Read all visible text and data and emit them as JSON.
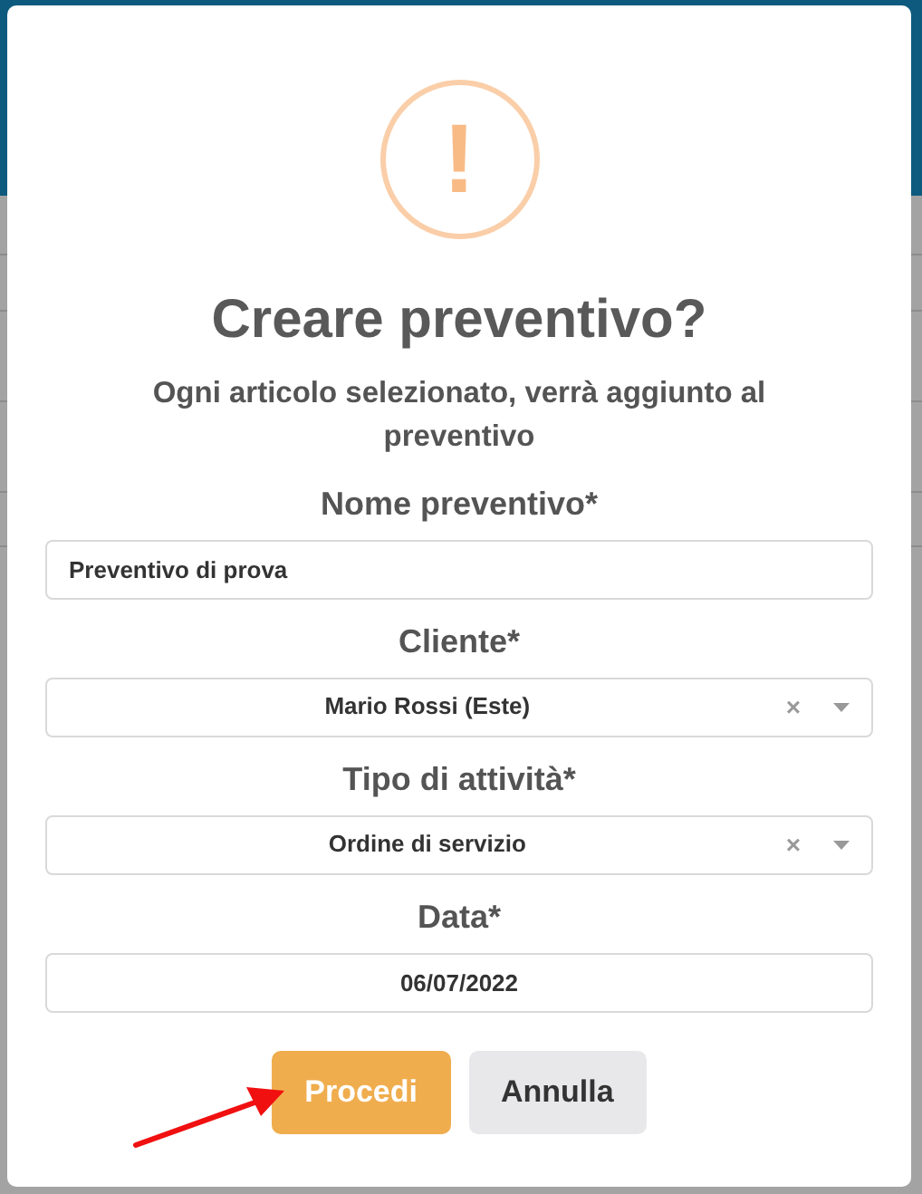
{
  "dialog": {
    "title": "Creare preventivo?",
    "message": "Ogni articolo selezionato, verrà aggiunto al preventivo",
    "fields": [
      {
        "kind": "text",
        "label": "Nome preventivo*",
        "value": "Preventivo di prova"
      },
      {
        "kind": "select",
        "label": "Cliente*",
        "value": "Mario Rossi (Este)",
        "clear": "×"
      },
      {
        "kind": "select",
        "label": "Tipo di attività*",
        "value": "Ordine di servizio",
        "clear": "×"
      },
      {
        "kind": "date",
        "label": "Data*",
        "value": "06/07/2022"
      }
    ],
    "buttons": [
      {
        "kind": "primary",
        "label": "Procedi"
      },
      {
        "kind": "secondary",
        "label": "Annulla"
      }
    ],
    "icon_glyph": "!"
  }
}
